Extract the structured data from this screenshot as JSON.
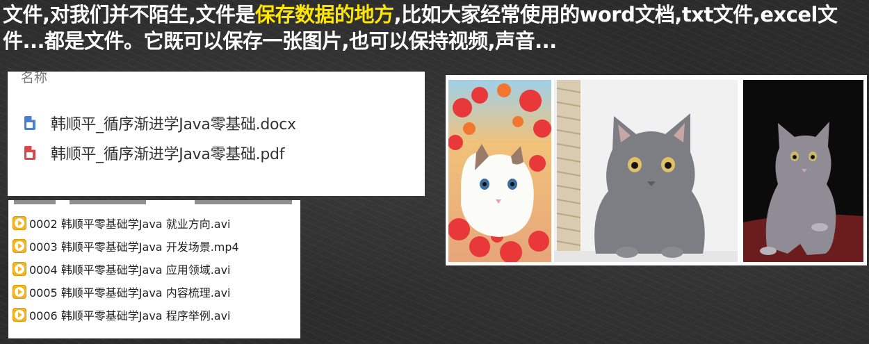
{
  "headline": {
    "part1": "文件,对我们并不陌生,文件是",
    "highlight": "保存数据的地方",
    "part2": ",比如大家经常使用的word文档,txt文件,excel文件...都是文件。它既可以保存一张图片,也可以保持视频,声音..."
  },
  "file_panel": {
    "column_header": "名称",
    "files": [
      {
        "name": "韩顺平_循序渐进学Java零基础.docx",
        "icon": "word-doc-icon"
      },
      {
        "name": "韩顺平_循序渐进学Java零基础.pdf",
        "icon": "pdf-icon"
      }
    ]
  },
  "video_panel": {
    "videos": [
      {
        "name": "0002 韩顺平零基础学Java 就业方向.avi",
        "icon": "video-file-icon"
      },
      {
        "name": "0003 韩顺平零基础学Java 开发场景.mp4",
        "icon": "video-file-icon"
      },
      {
        "name": "0004 韩顺平零基础学Java 应用领域.avi",
        "icon": "video-file-icon"
      },
      {
        "name": "0005 韩顺平零基础学Java 内容梳理.avi",
        "icon": "video-file-icon"
      },
      {
        "name": "0006 韩顺平零基础学Java 程序举例.avi",
        "icon": "video-file-icon"
      }
    ]
  },
  "images": [
    {
      "subject": "white kitten with red maple leaves"
    },
    {
      "subject": "grey kitten in front of scratching post"
    },
    {
      "subject": "grey kitten on dark background"
    }
  ],
  "colors": {
    "background": "#2b2b2b",
    "headline_text": "#ffffff",
    "headline_highlight": "#ffe600",
    "video_icon": "#f5b51d",
    "word_icon": "#4a7fd6",
    "pdf_icon": "#d44a4a"
  }
}
